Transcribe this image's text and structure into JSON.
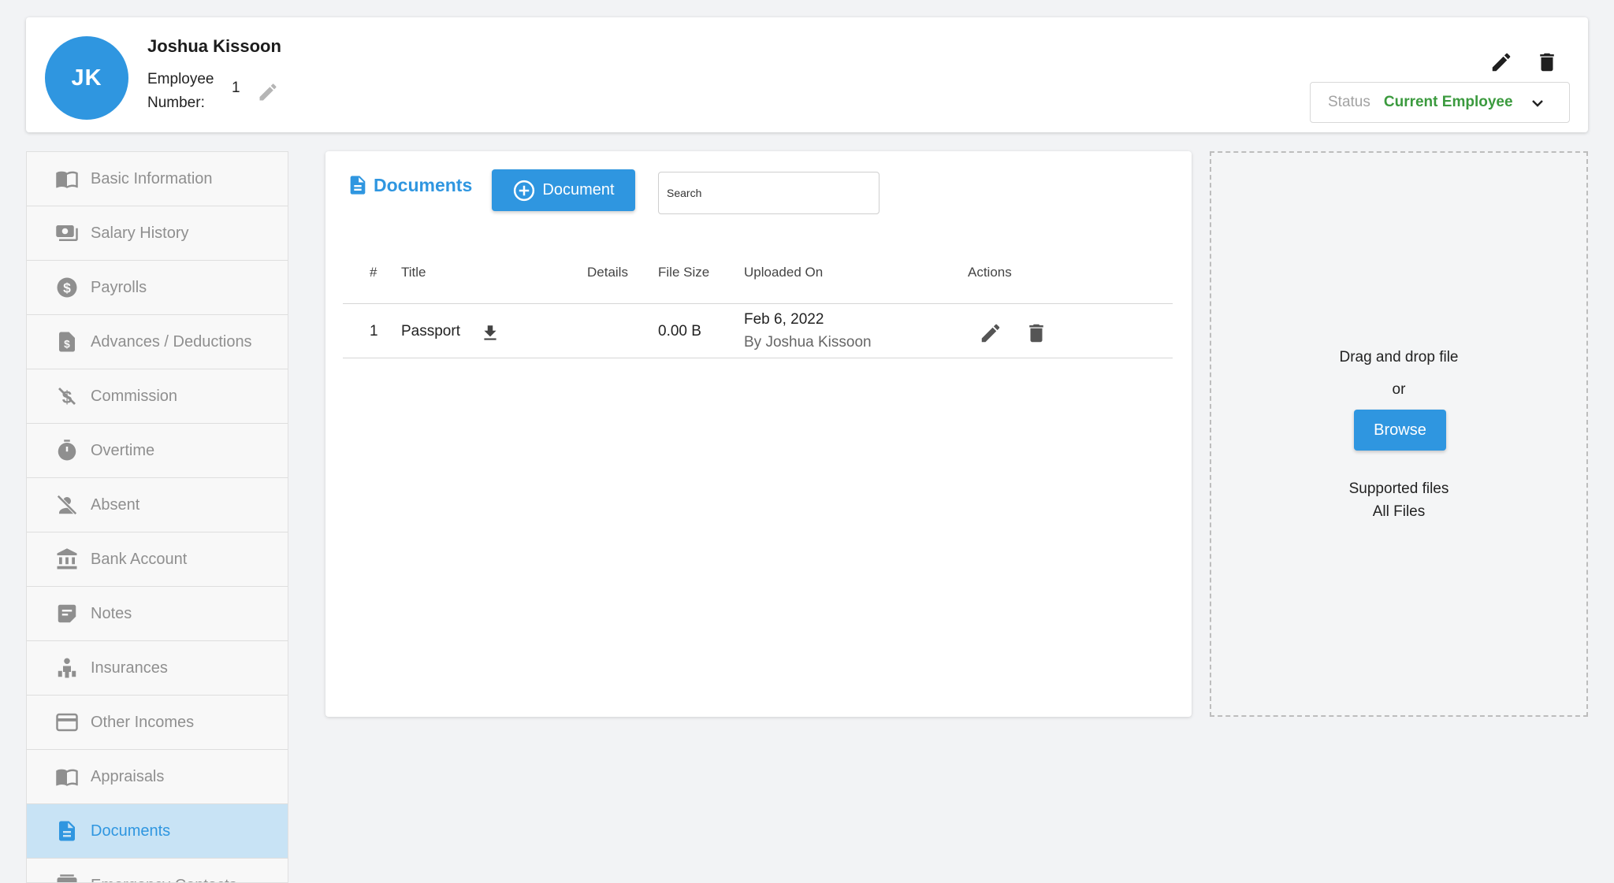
{
  "employee": {
    "initials": "JK",
    "name": "Joshua Kissoon",
    "number_label": "Employee Number:",
    "number": "1"
  },
  "status": {
    "label": "Status",
    "value": "Current Employee"
  },
  "sidebar": {
    "items": [
      {
        "label": "Basic Information",
        "icon": "book-icon"
      },
      {
        "label": "Salary History",
        "icon": "money-icon"
      },
      {
        "label": "Payrolls",
        "icon": "dollar-circle-icon"
      },
      {
        "label": "Advances / Deductions",
        "icon": "dollar-file-icon"
      },
      {
        "label": "Commission",
        "icon": "money-off-icon"
      },
      {
        "label": "Overtime",
        "icon": "timer-icon"
      },
      {
        "label": "Absent",
        "icon": "person-off-icon"
      },
      {
        "label": "Bank Account",
        "icon": "bank-icon"
      },
      {
        "label": "Notes",
        "icon": "note-icon"
      },
      {
        "label": "Insurances",
        "icon": "person-insurance-icon"
      },
      {
        "label": "Other Incomes",
        "icon": "credit-card-icon"
      },
      {
        "label": "Appraisals",
        "icon": "book-icon"
      },
      {
        "label": "Documents",
        "icon": "document-icon"
      },
      {
        "label": "Emergency Contacts",
        "icon": "contact-card-icon"
      }
    ],
    "active_index": 12
  },
  "documents": {
    "title": "Documents",
    "add_button_label": "Document",
    "search_placeholder": "Search",
    "columns": {
      "index": "#",
      "title": "Title",
      "details": "Details",
      "file_size": "File Size",
      "uploaded_on": "Uploaded On",
      "actions": "Actions"
    },
    "rows": [
      {
        "index": "1",
        "title": "Passport",
        "details": "",
        "file_size": "0.00 B",
        "uploaded_date": "Feb 6, 2022",
        "uploaded_by": "By Joshua Kissoon"
      }
    ]
  },
  "dropzone": {
    "text": "Drag and drop file",
    "or": "or",
    "browse_label": "Browse",
    "supported_label": "Supported files",
    "supported_value": "All Files"
  },
  "colors": {
    "primary": "#2f96e0",
    "status_green": "#3b9a3e",
    "sidebar_active_bg": "#c8e3f5"
  }
}
